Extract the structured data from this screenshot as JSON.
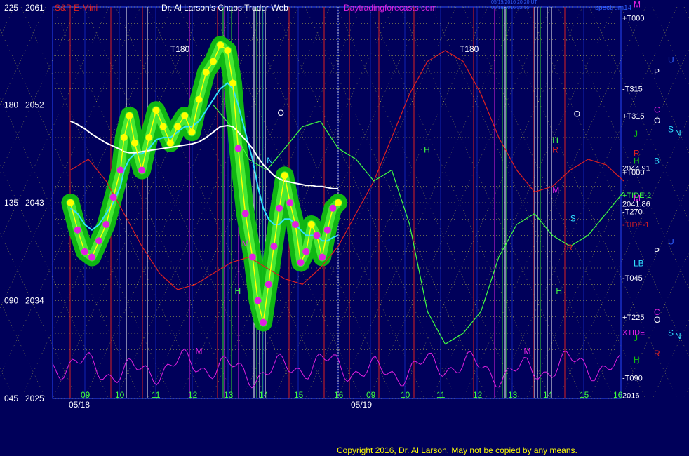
{
  "header": {
    "symbol": "S&P E-Mini",
    "title": "Dr. Al Larson's Chaos Trader Web",
    "site": "Daytradingforecasts.com",
    "stamp_line1": "05/19/2016 20:20 UT",
    "stamp_line2": "05/18/2016 22:15",
    "spectrum": "spectrum14"
  },
  "footer": {
    "copyright": "Copyright 2016, Dr. Al Larson. May not be copied by any means."
  },
  "colors": {
    "background": "#00005a",
    "grid_yellow": "#ffff40",
    "time_red": "#dd2020",
    "price": "#ffff00",
    "band": "#10c010",
    "magenta": "#e020e0",
    "cyan": "#30e0ff",
    "white": "#ffffff",
    "green_line": "#40ff40"
  },
  "chart_data": {
    "type": "line",
    "title": "S&P E-Mini",
    "price_axis": {
      "labels": [
        {
          "angle": "225",
          "price": "2061",
          "value": 2061
        },
        {
          "angle": "180",
          "price": "2052",
          "value": 2052
        },
        {
          "angle": "135",
          "price": "2043",
          "value": 2043
        },
        {
          "angle": "090",
          "price": "2034",
          "value": 2034
        },
        {
          "angle": "045",
          "price": "2025",
          "value": 2025
        }
      ],
      "ylim": [
        2025,
        2061
      ]
    },
    "hour_ticks": [
      {
        "label": "09",
        "day": 1
      },
      {
        "label": "10",
        "day": 1
      },
      {
        "label": "11",
        "day": 1
      },
      {
        "label": "12",
        "day": 1
      },
      {
        "label": "13",
        "day": 1
      },
      {
        "label": "14",
        "day": 1
      },
      {
        "label": "15",
        "day": 1
      },
      {
        "label": "16",
        "day": 1
      },
      {
        "label": "09",
        "day": 2
      },
      {
        "label": "10",
        "day": 2
      },
      {
        "label": "11",
        "day": 2
      },
      {
        "label": "12",
        "day": 2
      },
      {
        "label": "13",
        "day": 2
      },
      {
        "label": "14",
        "day": 2
      },
      {
        "label": "15",
        "day": 2
      },
      {
        "label": "16",
        "day": 2
      }
    ],
    "dates": [
      "05/18",
      "05/19"
    ],
    "price_series": {
      "name": "S&P E-Mini 05/18",
      "hours": [
        8.5,
        8.7,
        8.9,
        9.1,
        9.3,
        9.5,
        9.7,
        9.9,
        10.0,
        10.15,
        10.3,
        10.5,
        10.7,
        10.9,
        11.1,
        11.3,
        11.5,
        11.7,
        11.9,
        12.1,
        12.3,
        12.5,
        12.7,
        12.9,
        13.05,
        13.2,
        13.4,
        13.6,
        13.75,
        13.9,
        14.05,
        14.2,
        14.35,
        14.5,
        14.65,
        14.8,
        14.95,
        15.1,
        15.25,
        15.4,
        15.55,
        15.7,
        15.85,
        16.0
      ],
      "values": [
        2043.0,
        2040.5,
        2038.5,
        2038.0,
        2039.5,
        2041.0,
        2043.5,
        2046.0,
        2049.0,
        2051.0,
        2048.5,
        2046.0,
        2049.0,
        2051.5,
        2050.0,
        2048.5,
        2050.0,
        2051.0,
        2049.5,
        2052.5,
        2055.0,
        2056.0,
        2057.5,
        2057.0,
        2054.0,
        2048.0,
        2042.0,
        2038.0,
        2034.0,
        2032.0,
        2035.5,
        2039.0,
        2042.5,
        2045.5,
        2043.0,
        2041.0,
        2037.5,
        2038.5,
        2041.0,
        2040.0,
        2038.0,
        2040.5,
        2042.5,
        2043.0
      ]
    },
    "moving_avgs": [
      {
        "name": "cyan",
        "values": [
          2042.5,
          2042.0,
          2041.0,
          2040.5,
          2041.0,
          2042.0,
          2043.0,
          2044.5,
          2046.0,
          2047.0,
          2047.5,
          2047.5,
          2048.0,
          2048.8,
          2049.0,
          2049.0,
          2049.5,
          2050.0,
          2050.0,
          2050.5,
          2051.5,
          2052.5,
          2053.5,
          2054.0,
          2053.5,
          2052.0,
          2049.5,
          2047.0,
          2044.5,
          2042.5,
          2041.5,
          2041.0,
          2041.0,
          2041.5,
          2041.5,
          2041.0,
          2040.5,
          2040.0,
          2040.0,
          2040.0,
          2039.5,
          2039.5,
          2039.8,
          2040.0
        ]
      },
      {
        "name": "white",
        "values": [
          2050.5,
          2050.2,
          2049.8,
          2049.3,
          2048.9,
          2048.5,
          2048.2,
          2047.9,
          2047.7,
          2047.6,
          2047.6,
          2047.7,
          2047.8,
          2047.9,
          2048.0,
          2048.1,
          2048.2,
          2048.3,
          2048.4,
          2048.6,
          2049.0,
          2049.5,
          2050.0,
          2050.1,
          2050.0,
          2049.5,
          2048.8,
          2048.0,
          2047.2,
          2046.5,
          2046.0,
          2045.5,
          2045.2,
          2045.0,
          2044.9,
          2044.8,
          2044.7,
          2044.6,
          2044.6,
          2044.5,
          2044.5,
          2044.4,
          2044.3,
          2044.3
        ]
      }
    ],
    "projection": {
      "name": "red",
      "hours": [
        8.5,
        9.0,
        9.5,
        10.0,
        10.5,
        11.0,
        11.5,
        12.0,
        12.5,
        13.0,
        13.5,
        14.0,
        14.5,
        15.0,
        15.5,
        16.0,
        16.5,
        17.0,
        17.5,
        18.0,
        18.5,
        19.0,
        19.5,
        20.0,
        20.5,
        21.0,
        21.5,
        22.0,
        22.5,
        23.0,
        23.5,
        24.0
      ],
      "values": [
        2046.0,
        2047.0,
        2045.0,
        2042.0,
        2039.0,
        2036.5,
        2035.0,
        2035.5,
        2036.5,
        2037.5,
        2038.0,
        2037.0,
        2036.0,
        2035.5,
        2037.0,
        2039.0,
        2042.0,
        2045.0,
        2049.0,
        2053.0,
        2056.0,
        2057.0,
        2056.0,
        2053.0,
        2049.0,
        2046.0,
        2044.0,
        2044.5,
        2046.0,
        2047.0,
        2046.5,
        2045.0
      ]
    },
    "green_line": {
      "name": "green",
      "hours": [
        12.5,
        13.0,
        13.5,
        14.0,
        14.5,
        15.0,
        15.5,
        16.0,
        16.5,
        17.0,
        17.5,
        18.0,
        18.5,
        19.0,
        19.5,
        20.0,
        20.5,
        21.0,
        21.5,
        22.0,
        22.5,
        23.0,
        23.5,
        24.0
      ],
      "values": [
        2052.0,
        2050.0,
        2047.0,
        2046.0,
        2048.0,
        2050.0,
        2050.5,
        2048.0,
        2047.0,
        2045.0,
        2046.0,
        2041.0,
        2033.0,
        2030.0,
        2031.0,
        2033.0,
        2038.0,
        2041.0,
        2042.0,
        2040.0,
        2039.0,
        2040.0,
        2042.0,
        2044.0
      ]
    },
    "timeline_labels": [
      {
        "label": "T180",
        "hour": 11.3
      },
      {
        "label": "T180",
        "hour": 19.4
      },
      {
        "label": "H",
        "hour": 13.1,
        "value": 2034.6
      },
      {
        "label": "M",
        "hour": 12.0,
        "value": 2029.1
      },
      {
        "label": "M",
        "hour": 13.3,
        "value": 2039.0
      },
      {
        "label": "H",
        "hour": 22.1,
        "value": 2034.6
      },
      {
        "label": "M",
        "hour": 21.2,
        "value": 2029.1
      },
      {
        "label": "R",
        "hour": 22.4,
        "value": 2038.6
      },
      {
        "label": "M",
        "hour": 22.0,
        "value": 2043.9
      },
      {
        "label": "H",
        "hour": 22.0,
        "value": 2048.5
      },
      {
        "label": "S",
        "hour": 22.5,
        "value": 2041.3
      },
      {
        "label": "R",
        "hour": 22.0,
        "value": 2047.6
      },
      {
        "label": "N",
        "hour": 14.0,
        "value": 2046.6
      },
      {
        "label": "O",
        "hour": 14.3,
        "value": 2051.0
      },
      {
        "label": "O",
        "hour": 22.6,
        "value": 2050.9
      },
      {
        "label": "H",
        "hour": 18.4,
        "value": 2047.6
      }
    ],
    "right_labels": [
      {
        "label": "+T000",
        "value": 2060.0
      },
      {
        "label": "-T315",
        "value": 2053.5
      },
      {
        "label": "+T315",
        "value": 2051.0
      },
      {
        "label": "+T000",
        "value": 2045.8
      },
      {
        "label": "2044.91",
        "value": 2046.2
      },
      {
        "label": "+TIDE-2",
        "value": 2043.7
      },
      {
        "label": "2041.86",
        "value": 2042.9
      },
      {
        "label": "-T270",
        "value": 2042.2
      },
      {
        "label": "-TIDE-1",
        "value": 2041.0
      },
      {
        "label": "-T045",
        "value": 2036.1
      },
      {
        "label": "+T225",
        "value": 2032.5
      },
      {
        "label": "XTIDE",
        "value": 2031.1
      },
      {
        "label": "-T090",
        "value": 2026.9
      },
      {
        "label": "2016",
        "value": 2025.3
      }
    ],
    "planet_labels": [
      {
        "label": "M",
        "value": 2061.3,
        "color": "#e020e0",
        "col": 0
      },
      {
        "label": "U",
        "value": 2056.2,
        "color": "#3060ff",
        "col": 2
      },
      {
        "label": "P",
        "value": 2055.1,
        "color": "#ffffff",
        "col": 1
      },
      {
        "label": "C",
        "value": 2051.6,
        "color": "#e020e0",
        "col": 1
      },
      {
        "label": "O",
        "value": 2050.6,
        "color": "#ffffff",
        "col": 1
      },
      {
        "label": "S",
        "value": 2049.8,
        "color": "#30e0ff",
        "col": 2
      },
      {
        "label": "N",
        "value": 2049.5,
        "color": "#30e0ff",
        "col": 3
      },
      {
        "label": "J",
        "value": 2049.4,
        "color": "#10c010",
        "col": 0
      },
      {
        "label": "R",
        "value": 2047.6,
        "color": "#e02020",
        "col": 0
      },
      {
        "label": "B",
        "value": 2046.9,
        "color": "#30e0ff",
        "col": 1
      },
      {
        "label": "H",
        "value": 2046.9,
        "color": "#10c010",
        "col": 0
      },
      {
        "label": "M",
        "value": 2043.5,
        "color": "#e020e0",
        "col": 0
      },
      {
        "label": "U",
        "value": 2039.5,
        "color": "#3060ff",
        "col": 2
      },
      {
        "label": "P",
        "value": 2038.6,
        "color": "#ffffff",
        "col": 1
      },
      {
        "label": "LB",
        "value": 2037.5,
        "color": "#30e0ff",
        "col": 0
      },
      {
        "label": "C",
        "value": 2033.0,
        "color": "#e020e0",
        "col": 1
      },
      {
        "label": "O",
        "value": 2032.3,
        "color": "#ffffff",
        "col": 1
      },
      {
        "label": "S",
        "value": 2031.1,
        "color": "#30e0ff",
        "col": 2
      },
      {
        "label": "N",
        "value": 2030.8,
        "color": "#30e0ff",
        "col": 3
      },
      {
        "label": "J",
        "value": 2030.6,
        "color": "#10c010",
        "col": 0
      },
      {
        "label": "R",
        "value": 2029.2,
        "color": "#e02020",
        "col": 1
      },
      {
        "label": "H",
        "value": 2028.6,
        "color": "#10c010",
        "col": 0
      }
    ]
  }
}
